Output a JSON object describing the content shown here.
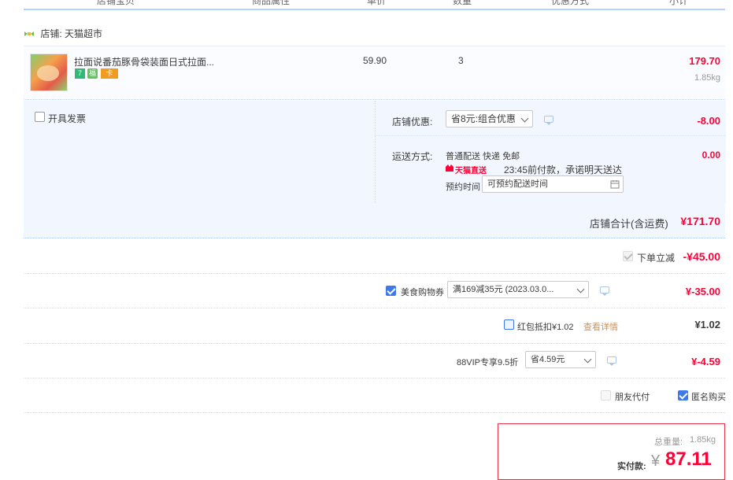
{
  "header": {
    "col_item": "店铺宝贝",
    "col_attr": "商品属性",
    "col_price": "单价",
    "col_qty": "数量",
    "col_discount": "优惠方式",
    "col_subtotal": "小计"
  },
  "shop": {
    "label": "店铺: 天猫超市"
  },
  "item": {
    "title": "拉面说番茄豚骨袋装面日式拉面...",
    "badges": [
      "7",
      "福",
      "卡"
    ],
    "unit_price": "59.90",
    "quantity": "3",
    "subtotal": "179.70",
    "weight": "1.85kg"
  },
  "invoice": {
    "label": "开具发票"
  },
  "store_discount": {
    "label": "店铺优惠:",
    "selected": "省8元:组合优惠",
    "amount": "-8.00"
  },
  "shipping": {
    "label": "运送方式:",
    "method": "普通配送 快递 免邮",
    "brand": "天猫直送",
    "promise": "23:45前付款，承诺明天送达",
    "schedule_label": "预约时间",
    "schedule_placeholder": "可预约配送时间",
    "amount": "0.00"
  },
  "store_total": {
    "label": "店铺合计(含运费)",
    "amount": "¥171.70"
  },
  "instant_discount": {
    "label": "下单立减",
    "amount": "-¥45.00"
  },
  "food_coupon": {
    "label": "美食购物券",
    "selected": "满169减35元 (2023.03.0...",
    "amount": "¥-35.00"
  },
  "red_packet": {
    "label": "红包抵扣¥1.02",
    "link": "查看详情",
    "amount": "¥1.02"
  },
  "vip": {
    "label": "88VIP专享9.5折",
    "selected": "省4.59元",
    "amount": "¥-4.59"
  },
  "options": {
    "friend_pay": "朋友代付",
    "anonymous": "匿名购买"
  },
  "summary": {
    "weight_label": "总重量:",
    "weight_value": "1.85kg",
    "pay_label": "实付款:",
    "currency": "¥",
    "pay_amount": "87.11"
  },
  "colors": {
    "accent": "#ff0036",
    "primary": "#3f79e8",
    "panel_bg": "#f2f7ff",
    "header_line": "#b2d1ff"
  },
  "state": {
    "invoice_checked": false,
    "instant_discount_checked": true,
    "food_coupon_checked": true,
    "red_packet_checked": false,
    "friend_pay_checked": false,
    "anonymous_checked": true
  }
}
